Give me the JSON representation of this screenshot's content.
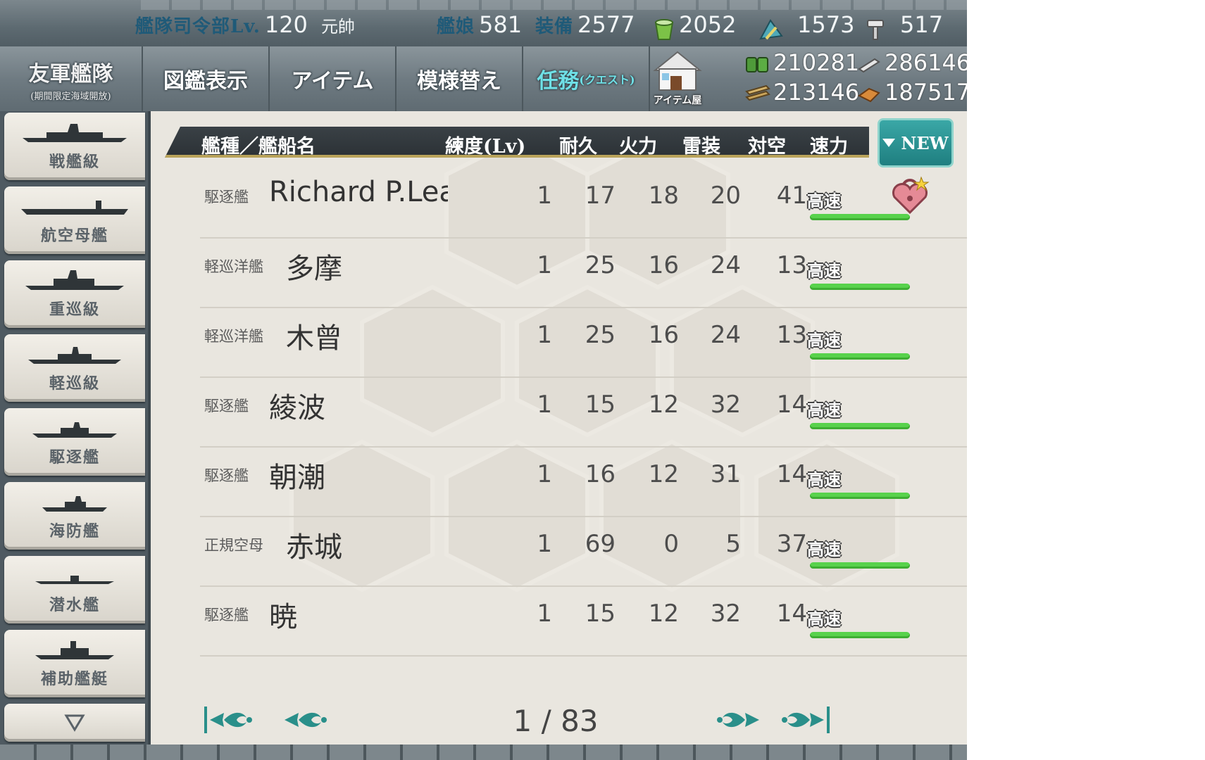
{
  "topbar": {
    "hq_label": "艦隊司令部Lv.",
    "hq_level": "120",
    "rank": "元帥",
    "ships_label": "艦娘",
    "ships_count": "581",
    "equip_label": "装備",
    "equip_count": "2577",
    "buckets": "2052",
    "dev_materials": "1573",
    "screws": "517"
  },
  "nav": {
    "allied": "友軍艦隊",
    "allied_sub": "(期間限定海域開放)",
    "encyclopedia": "図鑑表示",
    "items": "アイテム",
    "furniture": "模様替え",
    "quest": "任務",
    "quest_sub": "(クエスト)",
    "shop": "アイテム屋"
  },
  "resources": {
    "fuel": "210281",
    "ammo": "286146",
    "steel": "213146",
    "bauxite": "187517"
  },
  "sidebar": [
    "戦艦級",
    "航空母艦",
    "重巡級",
    "軽巡級",
    "駆逐艦",
    "海防艦",
    "潜水艦",
    "補助艦艇"
  ],
  "table": {
    "headers": {
      "name": "艦種／艦船名",
      "level": "練度(Lv)",
      "hp": "耐久",
      "firepower": "火力",
      "torpedo": "雷装",
      "aa": "対空",
      "speed": "速力"
    },
    "sort_button": "NEW",
    "rows": [
      {
        "type": "駆逐艦",
        "name": "Richard P.Lea",
        "lv": "1",
        "hp": "17",
        "fp": "18",
        "tp": "20",
        "aa": "41",
        "speed": "高速",
        "locked": true
      },
      {
        "type": "軽巡洋艦",
        "name": "多摩",
        "lv": "1",
        "hp": "25",
        "fp": "16",
        "tp": "24",
        "aa": "13",
        "speed": "高速",
        "locked": false
      },
      {
        "type": "軽巡洋艦",
        "name": "木曾",
        "lv": "1",
        "hp": "25",
        "fp": "16",
        "tp": "24",
        "aa": "13",
        "speed": "高速",
        "locked": false
      },
      {
        "type": "駆逐艦",
        "name": "綾波",
        "lv": "1",
        "hp": "15",
        "fp": "12",
        "tp": "32",
        "aa": "14",
        "speed": "高速",
        "locked": false
      },
      {
        "type": "駆逐艦",
        "name": "朝潮",
        "lv": "1",
        "hp": "16",
        "fp": "12",
        "tp": "31",
        "aa": "14",
        "speed": "高速",
        "locked": false
      },
      {
        "type": "正規空母",
        "name": "赤城",
        "lv": "1",
        "hp": "69",
        "fp": "0",
        "tp": "5",
        "aa": "37",
        "speed": "高速",
        "locked": false
      },
      {
        "type": "駆逐艦",
        "name": "暁",
        "lv": "1",
        "hp": "15",
        "fp": "12",
        "tp": "32",
        "aa": "14",
        "speed": "高速",
        "locked": false
      }
    ]
  },
  "pager": {
    "current": "1",
    "total": "83",
    "separator": "/"
  },
  "colors": {
    "accent": "#2a9c9b",
    "speed_bar": "#58d24c",
    "header_bg": "#2f363a"
  }
}
